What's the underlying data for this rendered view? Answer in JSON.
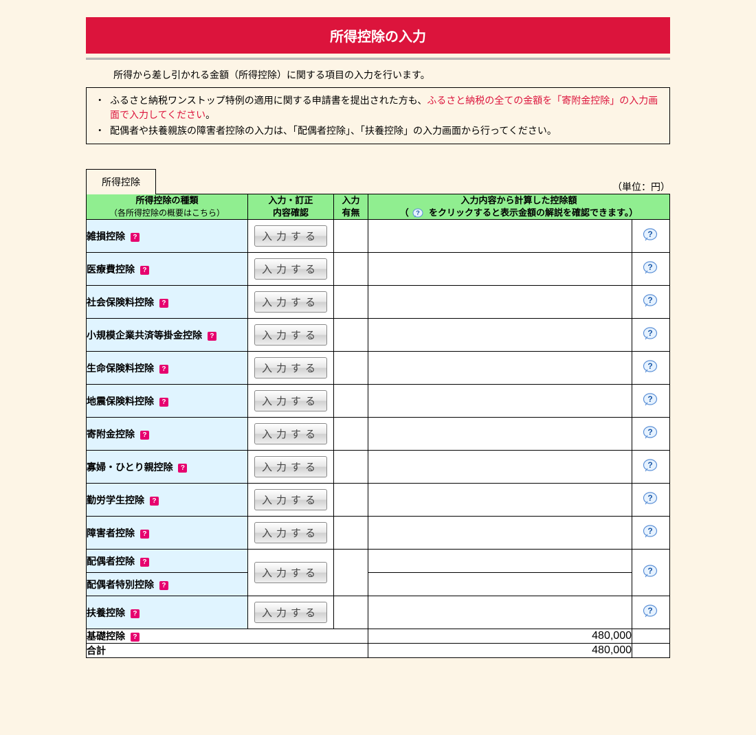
{
  "title": "所得控除の入力",
  "intro": "所得から差し引かれる金額（所得控除）に関する項目の入力を行います。",
  "notices": {
    "n1a": "ふるさと納税ワンストップ特例の適用に関する申請書を提出された方も、",
    "n1b": "ふるさと納税の全ての金額を「寄附金控除」の入力画面で入力してください",
    "n1c": "。",
    "n2": "配偶者や扶養親族の障害者控除の入力は、「配偶者控除」、「扶養控除」の入力画面から行ってください。"
  },
  "tab_label": "所得控除",
  "unit_label": "（単位：円）",
  "headers": {
    "type": "所得控除の種類",
    "type_sub": "（各所得控除の概要はこちら）",
    "btn": "入力・訂正\n内容確認",
    "flag": "入力\n有無",
    "amount_a": "入力内容から計算した控除額",
    "amount_b_pre": "（",
    "amount_b_post": "をクリックすると表示金額の解説を確認できます。）"
  },
  "button_label": "入力する",
  "rows_simple": [
    {
      "label": "雑損控除"
    },
    {
      "label": "医療費控除"
    },
    {
      "label": "社会保険料控除"
    },
    {
      "label": "小規模企業共済等掛金控除"
    },
    {
      "label": "生命保険料控除"
    },
    {
      "label": "地震保険料控除"
    },
    {
      "label": "寄附金控除"
    },
    {
      "label": "寡婦・ひとり親控除"
    },
    {
      "label": "勤労学生控除"
    },
    {
      "label": "障害者控除"
    }
  ],
  "spouse": {
    "label1": "配偶者控除",
    "label2": "配偶者特別控除"
  },
  "dependent": {
    "label": "扶養控除"
  },
  "base": {
    "label": "基礎控除",
    "amount": "480,000"
  },
  "total": {
    "label": "合計",
    "amount": "480,000"
  }
}
